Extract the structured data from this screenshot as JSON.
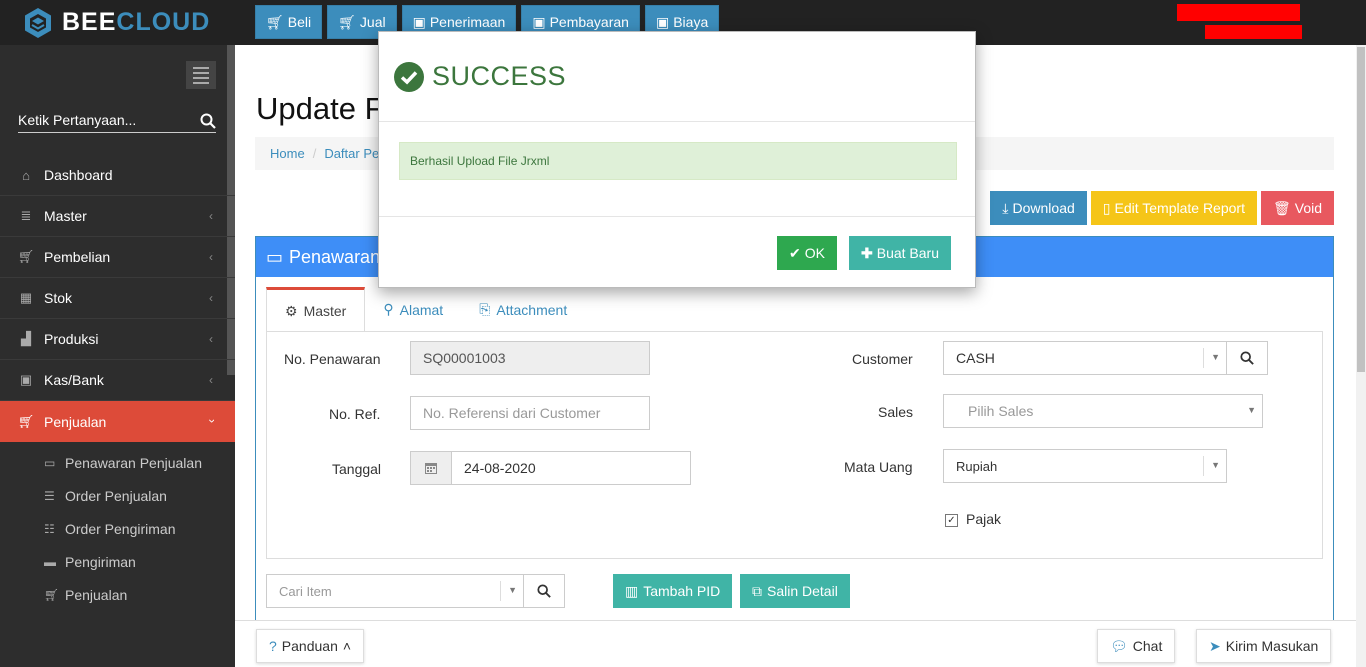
{
  "app": {
    "brand_part1": "BEE",
    "brand_part2": "CLOUD"
  },
  "topnav": [
    {
      "label": "Beli",
      "icon": "cart-icon"
    },
    {
      "label": "Jual",
      "icon": "cart-icon"
    },
    {
      "label": "Penerimaan",
      "icon": "money-icon"
    },
    {
      "label": "Pembayaran",
      "icon": "money-icon"
    },
    {
      "label": "Biaya",
      "icon": "money-icon"
    }
  ],
  "sidebar": {
    "search_placeholder": "Ketik Pertanyaan...",
    "items": [
      {
        "label": "Dashboard",
        "icon": "home-icon"
      },
      {
        "label": "Master",
        "icon": "database-icon"
      },
      {
        "label": "Pembelian",
        "icon": "cart-icon"
      },
      {
        "label": "Stok",
        "icon": "box-icon"
      },
      {
        "label": "Produksi",
        "icon": "factory-icon"
      },
      {
        "label": "Kas/Bank",
        "icon": "money-icon"
      },
      {
        "label": "Penjualan",
        "icon": "cart-icon"
      }
    ],
    "submenu": [
      {
        "label": "Penawaran Penjualan",
        "icon": "card-icon"
      },
      {
        "label": "Order Penjualan",
        "icon": "list-icon"
      },
      {
        "label": "Order Pengiriman",
        "icon": "list-ordered-icon"
      },
      {
        "label": "Pengiriman",
        "icon": "truck-icon"
      },
      {
        "label": "Penjualan",
        "icon": "cart-icon"
      }
    ]
  },
  "page": {
    "title": "Update F",
    "breadcrumb": [
      "Home",
      "Daftar Pe"
    ]
  },
  "actions": {
    "download": "Download",
    "edit_template": "Edit Template Report",
    "void": "Void"
  },
  "panel": {
    "title": "Penawaran",
    "tabs": [
      "Master",
      "Alamat",
      "Attachment"
    ],
    "form": {
      "no_penawaran_label": "No. Penawaran",
      "no_penawaran_value": "SQ00001003",
      "no_ref_label": "No. Ref.",
      "no_ref_placeholder": "No. Referensi dari Customer",
      "tanggal_label": "Tanggal",
      "tanggal_value": "24-08-2020",
      "customer_label": "Customer",
      "customer_value": "CASH",
      "sales_label": "Sales",
      "sales_placeholder": "Pilih Sales",
      "mata_uang_label": "Mata Uang",
      "mata_uang_value": "Rupiah",
      "pajak_label": "Pajak"
    },
    "cari_item_placeholder": "Cari Item",
    "tambah_pid": "Tambah PID",
    "salin_detail": "Salin Detail"
  },
  "footer": {
    "panduan": "Panduan",
    "chat": "Chat",
    "kirim_masukan": "Kirim Masukan"
  },
  "modal": {
    "title": "SUCCESS",
    "message": "Berhasil Upload File Jrxml",
    "ok": "OK",
    "buat_baru": "Buat Baru"
  },
  "colors": {
    "accent": "#3c8dbc",
    "active_menu": "#dd4b39",
    "success": "#3c763d"
  }
}
